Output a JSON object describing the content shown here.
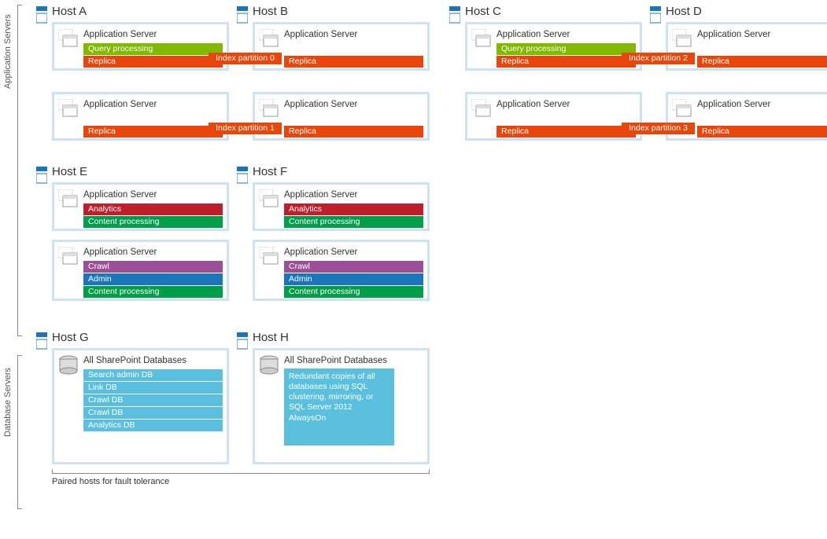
{
  "sections": {
    "app_label": "Application Servers",
    "db_label": "Database Servers"
  },
  "footer": {
    "note": "Paired hosts for fault tolerance"
  },
  "idx": {
    "p0": "Index partition 0",
    "p1": "Index partition 1",
    "p2": "Index partition 2",
    "p3": "Index partition 3"
  },
  "roles": {
    "query": "Query processing",
    "replica": "Replica",
    "analytics": "Analytics",
    "content": "Content processing",
    "crawl": "Crawl",
    "admin": "Admin"
  },
  "labels": {
    "appserver": "Application Server",
    "allspdb": "All SharePoint Databases"
  },
  "hosts": {
    "A": "Host A",
    "B": "Host B",
    "C": "Host C",
    "D": "Host D",
    "E": "Host E",
    "F": "Host F",
    "G": "Host G",
    "H": "Host H"
  },
  "dbs": {
    "searchadmin": "Search admin DB",
    "link": "Link DB",
    "crawl1": "Crawl DB",
    "crawl2": "Crawl DB",
    "analytics": "Analytics DB"
  },
  "dbnote": "Redundant copies of all databases using SQL clustering, mirroring, or SQL Server 2012 AlwaysOn",
  "colors": {
    "frontgreen": "#7fba00",
    "orange": "#e8460b",
    "crimson": "#bf1e2d",
    "teal": "#009e49",
    "purple": "#9b4f96",
    "blue": "#1b75bb",
    "sky": "#5bc0de",
    "boxborder": "#cce4f0"
  }
}
